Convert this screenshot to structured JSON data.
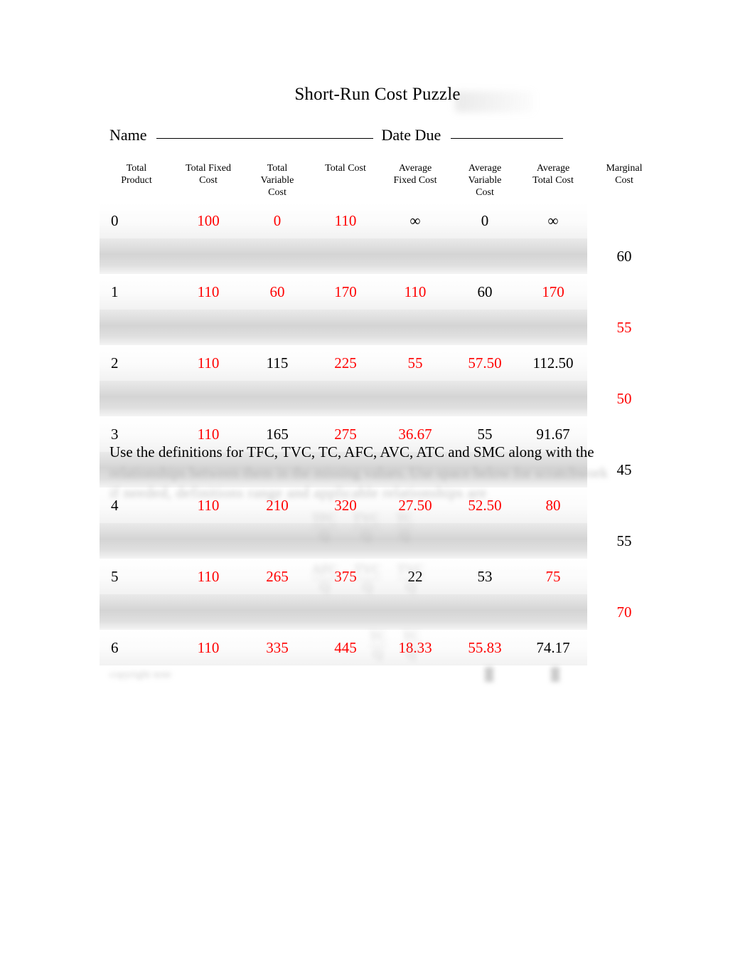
{
  "document": {
    "title": "Short-Run Cost Puzzle",
    "name_label": "Name",
    "date_label": "Date Due"
  },
  "colors": {
    "answer_red": "#ff0000",
    "given_black": "#000000",
    "row_band": "#d4d4d4",
    "page_background": "#ffffff"
  },
  "table": {
    "headers": [
      "Total Product",
      "Total Fixed Cost",
      "Total Variable Cost",
      "Total Cost",
      "Average Fixed Cost",
      "Average Variable Cost",
      "Average Total Cost",
      "Marginal Cost"
    ],
    "header_lines": [
      [
        "Total",
        "Product"
      ],
      [
        "Total Fixed",
        "Cost"
      ],
      [
        "Total",
        "Variable",
        "Cost"
      ],
      [
        "Total Cost"
      ],
      [
        "Average",
        "Fixed Cost"
      ],
      [
        "Average",
        "Variable",
        "Cost"
      ],
      [
        "Average",
        "Total Cost"
      ],
      [
        "Marginal",
        "Cost"
      ]
    ],
    "rows": [
      {
        "total_product": "0",
        "total_fixed_cost": "100",
        "total_variable_cost": "0",
        "total_cost": "110",
        "average_fixed_cost": "∞",
        "average_variable_cost": "0",
        "average_total_cost": "∞",
        "colors": {
          "total_product": "black",
          "total_fixed_cost": "red",
          "total_variable_cost": "red",
          "total_cost": "red",
          "average_fixed_cost": "black",
          "average_variable_cost": "black",
          "average_total_cost": "black"
        }
      },
      {
        "total_product": "1",
        "total_fixed_cost": "110",
        "total_variable_cost": "60",
        "total_cost": "170",
        "average_fixed_cost": "110",
        "average_variable_cost": "60",
        "average_total_cost": "170",
        "colors": {
          "total_product": "black",
          "total_fixed_cost": "red",
          "total_variable_cost": "red",
          "total_cost": "red",
          "average_fixed_cost": "red",
          "average_variable_cost": "black",
          "average_total_cost": "red"
        }
      },
      {
        "total_product": "2",
        "total_fixed_cost": "110",
        "total_variable_cost": "115",
        "total_cost": "225",
        "average_fixed_cost": "55",
        "average_variable_cost": "57.50",
        "average_total_cost": "112.50",
        "colors": {
          "total_product": "black",
          "total_fixed_cost": "red",
          "total_variable_cost": "black",
          "total_cost": "red",
          "average_fixed_cost": "red",
          "average_variable_cost": "red",
          "average_total_cost": "black"
        }
      },
      {
        "total_product": "3",
        "total_fixed_cost": "110",
        "total_variable_cost": "165",
        "total_cost": "275",
        "average_fixed_cost": "36.67",
        "average_variable_cost": "55",
        "average_total_cost": "91.67",
        "colors": {
          "total_product": "black",
          "total_fixed_cost": "red",
          "total_variable_cost": "black",
          "total_cost": "red",
          "average_fixed_cost": "red",
          "average_variable_cost": "black",
          "average_total_cost": "black"
        }
      },
      {
        "total_product": "4",
        "total_fixed_cost": "110",
        "total_variable_cost": "210",
        "total_cost": "320",
        "average_fixed_cost": "27.50",
        "average_variable_cost": "52.50",
        "average_total_cost": "80",
        "colors": {
          "total_product": "black",
          "total_fixed_cost": "red",
          "total_variable_cost": "red",
          "total_cost": "red",
          "average_fixed_cost": "red",
          "average_variable_cost": "red",
          "average_total_cost": "red"
        }
      },
      {
        "total_product": "5",
        "total_fixed_cost": "110",
        "total_variable_cost": "265",
        "total_cost": "375",
        "average_fixed_cost": "22",
        "average_variable_cost": "53",
        "average_total_cost": "75",
        "colors": {
          "total_product": "black",
          "total_fixed_cost": "red",
          "total_variable_cost": "red",
          "total_cost": "red",
          "average_fixed_cost": "black",
          "average_variable_cost": "black",
          "average_total_cost": "red"
        }
      },
      {
        "total_product": "6",
        "total_fixed_cost": "110",
        "total_variable_cost": "335",
        "total_cost": "445",
        "average_fixed_cost": "18.33",
        "average_variable_cost": "55.83",
        "average_total_cost": "74.17",
        "colors": {
          "total_product": "black",
          "total_fixed_cost": "red",
          "total_variable_cost": "red",
          "total_cost": "red",
          "average_fixed_cost": "red",
          "average_variable_cost": "red",
          "average_total_cost": "black"
        }
      }
    ],
    "marginal_costs": [
      {
        "value": "60",
        "color": "black"
      },
      {
        "value": "55",
        "color": "red"
      },
      {
        "value": "50",
        "color": "red"
      },
      {
        "value": "45",
        "color": "black"
      },
      {
        "value": "55",
        "color": "black"
      },
      {
        "value": "70",
        "color": "red"
      }
    ]
  },
  "instructions": {
    "line1": "Use the definitions for TFC, TVC, TC, AFC, AVC, ATC and SMC along with the",
    "line2_illegible": "relationships between them in the missing values. Use space below for scratchwork",
    "line3_illegible": "if needed, definitions range and applicable relationships are"
  },
  "formulas_illegible": {
    "group1": [
      {
        "numerator": "TFC",
        "denominator": "Q"
      },
      {
        "numerator": "TVC",
        "denominator": "Q"
      },
      {
        "numerator": "TC",
        "denominator": "Q"
      }
    ],
    "group2": [
      {
        "numerator": "AFC",
        "denominator": "Q"
      },
      {
        "numerator": "TVC",
        "denominator": "Q"
      },
      {
        "numerator": "TVC",
        "denominator": "Q"
      }
    ],
    "group3": [
      {
        "numerator": "TC",
        "denominator": "Q"
      },
      {
        "numerator": "TC",
        "denominator": "Q"
      }
    ]
  },
  "footer_illegible": "copyright note"
}
